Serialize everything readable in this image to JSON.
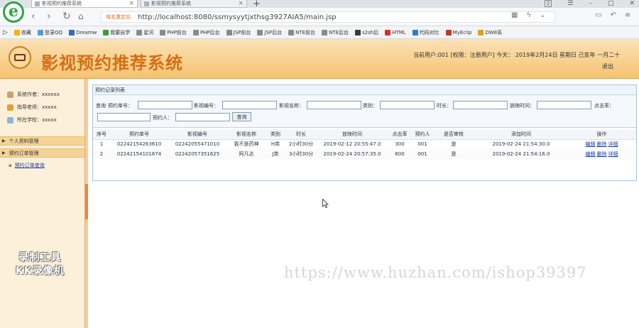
{
  "browser": {
    "tabs": [
      {
        "title": "影视预约推荐系统"
      },
      {
        "title": "影视预约推荐系统"
      }
    ],
    "new_tab": "+",
    "tab_count": "2",
    "url_tag": "域名重定向",
    "url": "http://localhost:8080/ssmysyytjxthsg3927AIA5/main.jsp",
    "bookmarks": [
      {
        "label": "收藏",
        "color": "#f5b400"
      },
      {
        "label": "登录QQ",
        "color": "#5a9bd5"
      },
      {
        "label": "Dreamw",
        "color": "#3b6cb3"
      },
      {
        "label": "我要自学",
        "color": "#3d9c3d"
      },
      {
        "label": "星河",
        "color": "#8a8a8a"
      },
      {
        "label": "PHP前台",
        "color": "#8a8a8a"
      },
      {
        "label": "PHP后台",
        "color": "#8a8a8a"
      },
      {
        "label": "JSP前台",
        "color": "#8a8a8a"
      },
      {
        "label": "JSP后台",
        "color": "#8a8a8a"
      },
      {
        "label": "NTE前台",
        "color": "#8a8a8a"
      },
      {
        "label": "NTE后台",
        "color": "#8a8a8a"
      },
      {
        "label": "s2sh后",
        "color": "#3a3a3a"
      },
      {
        "label": "HTML",
        "color": "#d9302c"
      },
      {
        "label": "代码对比",
        "color": "#2b7bd6"
      },
      {
        "label": "MyEclip",
        "color": "#c0392b"
      },
      {
        "label": "DW8系",
        "color": "#e0a020"
      }
    ]
  },
  "header": {
    "title": "影视预约推荐系统",
    "user_info": "当前用户:001 [权限：注册用户] 今天： 2019年2月24日 星期日 己亥年 一月二十",
    "logout": "退出"
  },
  "sidebar": {
    "info": [
      {
        "label": "系统作者：xxxxxx"
      },
      {
        "label": "指导老师：xxxxx"
      },
      {
        "label": "所在学校：xxxxx"
      }
    ],
    "sections": [
      {
        "label": "个人资料管理"
      },
      {
        "label": "预约订单管理"
      }
    ],
    "links": [
      {
        "label": "预约订单查询"
      }
    ]
  },
  "panel": {
    "title": "预约记录列表",
    "search": {
      "prefix": "查询",
      "fields": [
        {
          "label": "预约单号：",
          "value": ""
        },
        {
          "label": "影视编号：",
          "value": ""
        },
        {
          "label": "影视名称：",
          "value": ""
        },
        {
          "label": "类别：",
          "value": ""
        },
        {
          "label": "时长：",
          "value": ""
        },
        {
          "label": "放映时间：",
          "value": ""
        },
        {
          "label": "点击率：",
          "value": ""
        },
        {
          "label": "预约人：",
          "value": ""
        }
      ],
      "button": "查询"
    },
    "columns": [
      "序号",
      "预约单号",
      "影视编号",
      "影视名称",
      "类别",
      "时长",
      "放映时间",
      "点击率",
      "预约人",
      "是否审核",
      "添加时间",
      "操作"
    ],
    "rows": [
      [
        "1",
        "02242154263610",
        "02242055471010",
        "我不是药神",
        "H类",
        "2小时30分",
        "2019-02-12 20:55:47.0",
        "300",
        "001",
        "是",
        "2019-02-24 21:54:30.0"
      ],
      [
        "2",
        "02242154101874",
        "02242057351625",
        "阿凡达",
        "J类",
        "3小时30分",
        "2019-02-24 20:57:35.0",
        "600",
        "001",
        "是",
        "2019-02-24 21:54:16.0"
      ]
    ],
    "actions": [
      "编辑",
      "删除",
      "详细"
    ]
  },
  "overlays": {
    "recorder_line1": "录制工具",
    "recorder_line2": "KK录像机",
    "site_url": "https://www.huzhan.com/ishop39397"
  }
}
